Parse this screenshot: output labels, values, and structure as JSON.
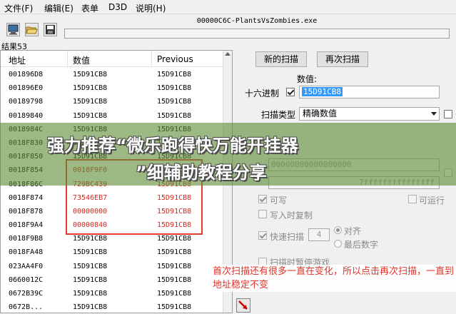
{
  "menu": [
    "文件(F)",
    "编辑(E)",
    "表单",
    "D3D",
    "说明(H)"
  ],
  "process_title": "00000C6C-PlantsVsZombies.exe",
  "results_label": "结果53",
  "columns": [
    "地址",
    "数值",
    "Previous"
  ],
  "rows": [
    {
      "addr": "001896D8",
      "value": "15D91CB8",
      "prev": "15D91CB8",
      "changed": false
    },
    {
      "addr": "001896E0",
      "value": "15D91CB8",
      "prev": "15D91CB8",
      "changed": false
    },
    {
      "addr": "00189798",
      "value": "15D91CB8",
      "prev": "15D91CB8",
      "changed": false
    },
    {
      "addr": "00189840",
      "value": "15D91CB8",
      "prev": "15D91CB8",
      "changed": false
    },
    {
      "addr": "0018984C",
      "value": "15D91CB8",
      "prev": "15D91CB8",
      "changed": false
    },
    {
      "addr": "0018F830",
      "value": "15D91CB8",
      "prev": "15D91CB8",
      "changed": false
    },
    {
      "addr": "0018F850",
      "value": "15D91CB8",
      "prev": "15D91CB8",
      "changed": false
    },
    {
      "addr": "0018F854",
      "value": "0018F9F0",
      "prev": "15D91CB8",
      "changed": true
    },
    {
      "addr": "0018F86C",
      "value": "729BC439",
      "prev": "15D91CB8",
      "changed": true
    },
    {
      "addr": "0018F874",
      "value": "73546EB7",
      "prev": "15D91CB8",
      "changed": true
    },
    {
      "addr": "0018F878",
      "value": "00000000",
      "prev": "15D91CB8",
      "changed": true
    },
    {
      "addr": "0018F9A4",
      "value": "00000840",
      "prev": "15D91CB8",
      "changed": true
    },
    {
      "addr": "0018F9B8",
      "value": "15D91CB8",
      "prev": "15D91CB8",
      "changed": false
    },
    {
      "addr": "0018FA48",
      "value": "15D91CB8",
      "prev": "15D91CB8",
      "changed": false
    },
    {
      "addr": "023AA4F0",
      "value": "15D91CB8",
      "prev": "15D91CB8",
      "changed": false
    },
    {
      "addr": "0660012C",
      "value": "15D91CB8",
      "prev": "15D91CB8",
      "changed": false
    },
    {
      "addr": "0672B39C",
      "value": "15D91CB8",
      "prev": "15D91CB8",
      "changed": false
    },
    {
      "addr": "0672B...",
      "value": "15D91CB8",
      "prev": "15D91CB8",
      "changed": false
    }
  ],
  "scan": {
    "new_scan": "新的扫描",
    "next_scan": "再次扫描",
    "value_label": "数值:",
    "hex_label": "十六进制",
    "hex_checked": true,
    "value": "15D91CB8",
    "scan_type_label": "扫描类型",
    "scan_type": "精确数值",
    "mem_start": "00000000000000000",
    "mem_stop": "7fffffffffffffff",
    "writable": "可写",
    "executable": "可运行",
    "copy_on_write": "写入时复制",
    "fast_scan": "快速扫描",
    "fast_scan_value": "4",
    "align": "对齐",
    "last_digits": "最后数字",
    "pause_game": "扫描时暂停游戏"
  },
  "banner": {
    "line1": "强力推荐“微乐跑得快万能开挂器",
    "line2": "”细辅助教程分享"
  },
  "note": "首次扫描还有很多一直在变化，所以点击再次扫描，一直到地址稳定不变",
  "colors": {
    "changed_value": "#d9261c",
    "annotation": "#e0342a",
    "selection": "#3399ff"
  }
}
